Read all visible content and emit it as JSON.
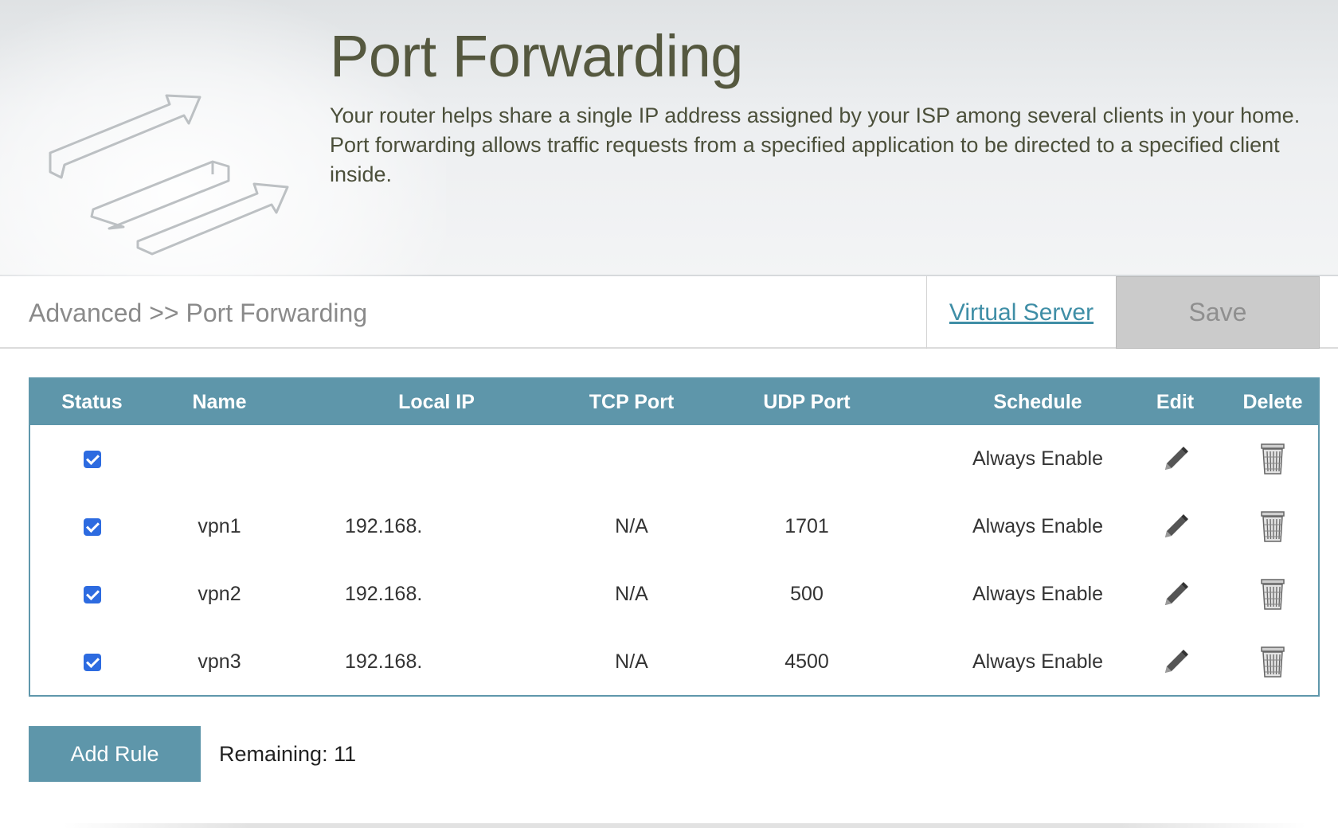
{
  "header": {
    "title": "Port Forwarding",
    "description": "Your router helps share a single IP address assigned by your ISP among several clients in your home. Port forwarding allows traffic requests from a specified application to be directed to a specified client inside."
  },
  "toolbar": {
    "breadcrumb": "Advanced >> Port Forwarding",
    "virtual_server_label": "Virtual Server",
    "save_label": "Save"
  },
  "table": {
    "columns": {
      "status": "Status",
      "name": "Name",
      "local_ip": "Local IP",
      "tcp_port": "TCP Port",
      "udp_port": "UDP Port",
      "schedule": "Schedule",
      "edit": "Edit",
      "delete": "Delete"
    },
    "rows": [
      {
        "status": true,
        "name": "",
        "local_ip": "",
        "tcp_port": "",
        "udp_port": "",
        "schedule": "Always Enable"
      },
      {
        "status": true,
        "name": "vpn1",
        "local_ip": "192.168.",
        "tcp_port": "N/A",
        "udp_port": "1701",
        "schedule": "Always Enable"
      },
      {
        "status": true,
        "name": "vpn2",
        "local_ip": "192.168.",
        "tcp_port": "N/A",
        "udp_port": "500",
        "schedule": "Always Enable"
      },
      {
        "status": true,
        "name": "vpn3",
        "local_ip": "192.168.",
        "tcp_port": "N/A",
        "udp_port": "4500",
        "schedule": "Always Enable"
      }
    ]
  },
  "footer": {
    "add_rule_label": "Add Rule",
    "remaining_label": "Remaining:",
    "remaining_count": "11"
  },
  "icons": {
    "header": "port-forwarding-arrows-icon",
    "checkbox": "checkbox-checked",
    "edit": "pencil-icon",
    "delete": "trash-icon"
  },
  "colors": {
    "accent": "#5e96aa",
    "title": "#55583f",
    "link": "#3f8ea6",
    "save_disabled": "#cbcbcb"
  }
}
